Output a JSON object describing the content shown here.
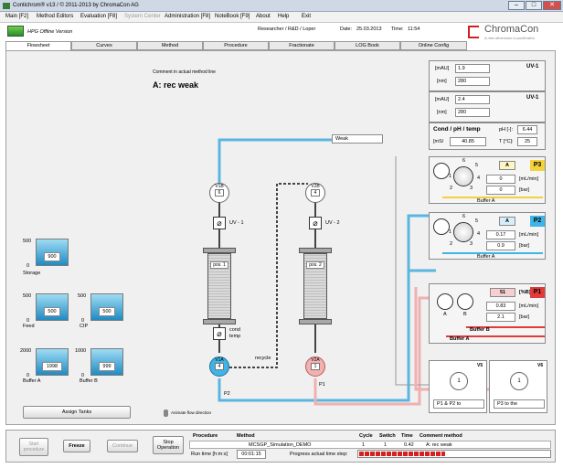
{
  "window": {
    "title": "Contichrom® v13 / © 2011-2013 by ChromaCon AG"
  },
  "menu": [
    "Main [F2]",
    "Method Editors",
    "Evaluation [F8]",
    "System Center",
    "Administration [F8]",
    "NoteBook [F9]",
    "About",
    "Help",
    "Exit"
  ],
  "info": {
    "mode": "HPG Offline Version",
    "user": "Researcher / R&D / Loper",
    "date_label": "Date:",
    "date": "25.03.2013",
    "time_label": "Time:",
    "time": "11:54",
    "brand": "ChromaCon",
    "tagline": "A new dimension in purification"
  },
  "tabs": [
    "Flowsheet",
    "Curves",
    "Method",
    "Procedure",
    "Fractionate",
    "LOG Book",
    "Online Config"
  ],
  "flowsheet": {
    "comment_label": "Comment in actual method line",
    "method_name": "A: rec weak",
    "weak_label": "Weak",
    "recycle_label": "recycle",
    "p2_label": "P2",
    "p1_label": "P1",
    "animate_label": "Animate flow direction",
    "assign_tanks": "Assign Tanks"
  },
  "valves": {
    "v1b": {
      "name": "V1B",
      "value": "6"
    },
    "v2b": {
      "name": "V2B",
      "value": "4"
    },
    "v1a": {
      "name": "V1A",
      "value": "4"
    },
    "v2a": {
      "name": "V2A",
      "value": "1"
    }
  },
  "uv_labels": {
    "uv1": "UV - 1",
    "uv2": "UV - 2"
  },
  "columns": {
    "pos1": "pos. 1",
    "pos2": "pos. 2"
  },
  "cond_temp": {
    "line1": "cond",
    "line2": "temp"
  },
  "tanks": [
    {
      "name": "Storage",
      "value": "900",
      "scale_top": "500",
      "scale_bottom": "0"
    },
    {
      "name": "Feed",
      "value": "500",
      "scale_top": "500",
      "scale_bottom": "0"
    },
    {
      "name": "CIP",
      "value": "500",
      "scale_top": "500",
      "scale_bottom": "0"
    },
    {
      "name": "Buffer A",
      "value": "1998",
      "scale_top": "2000",
      "scale_bottom": "0"
    },
    {
      "name": "Buffer B",
      "value": "999",
      "scale_top": "1000",
      "scale_bottom": "0"
    }
  ],
  "detectors": [
    {
      "id": "UV-1",
      "mau": "1.9",
      "nm": "280"
    },
    {
      "id": "UV-1",
      "mau": "2.4",
      "nm": "280"
    }
  ],
  "units": {
    "mau": "[mAU]",
    "nm": "[nm]",
    "ms": "[mS/",
    "ml_min": "[mL/min]",
    "bar": "[bar]",
    "pct_b": "[%B]"
  },
  "cond_ph_temp": {
    "title": "Cond / pH / temp",
    "ph_label": "pH [-]:",
    "ph": "6.44",
    "cond": "40.85",
    "temp_label": "T [°C]:",
    "temp": "25"
  },
  "pumps": [
    {
      "id": "P3",
      "channel": "A",
      "flow": "0",
      "pressure": "0",
      "buffer": "Buffer A",
      "color": "#f3d23b"
    },
    {
      "id": "P2",
      "channel": "A",
      "flow": "0.17",
      "pressure": "0.9",
      "buffer": "Buffer A",
      "color": "#3fb4e6"
    },
    {
      "id": "P1",
      "channel": "51",
      "flow": "0.83",
      "pressure": "2.1",
      "buffer_a": "Buffer A",
      "buffer_b": "Buffer B",
      "color": "#e13a3a"
    }
  ],
  "dial_numbers": [
    "6",
    "5",
    "4",
    "3",
    "2",
    "1"
  ],
  "v_switches": [
    {
      "id": "V5",
      "value": "1",
      "label": "P1 & P2 to"
    },
    {
      "id": "V6",
      "value": "1",
      "label": "P3 to the"
    }
  ],
  "controls": {
    "start": "Start procedure",
    "freeze": "Freeze",
    "continue": "Continue",
    "stop": "Stop Operation"
  },
  "procedure": {
    "headers": [
      "Procedure",
      "Method",
      "Cycle",
      "Switch",
      "Time",
      "Comment method"
    ],
    "values": [
      "",
      "MCSGP_Simulation_DEMO",
      "1",
      "1",
      "0.42",
      "A: rec weak"
    ],
    "runtime_label": "Run time [h:m:s]",
    "runtime": "00:01:15",
    "progress_label": "Progress actual time step:",
    "progress": 0.45
  },
  "colors": {
    "accent_red": "#e13a3a",
    "accent_blue": "#3fb4e6",
    "accent_yellow": "#f3d23b",
    "line_gray": "#444444",
    "line_blue": "#5ab6e0"
  }
}
